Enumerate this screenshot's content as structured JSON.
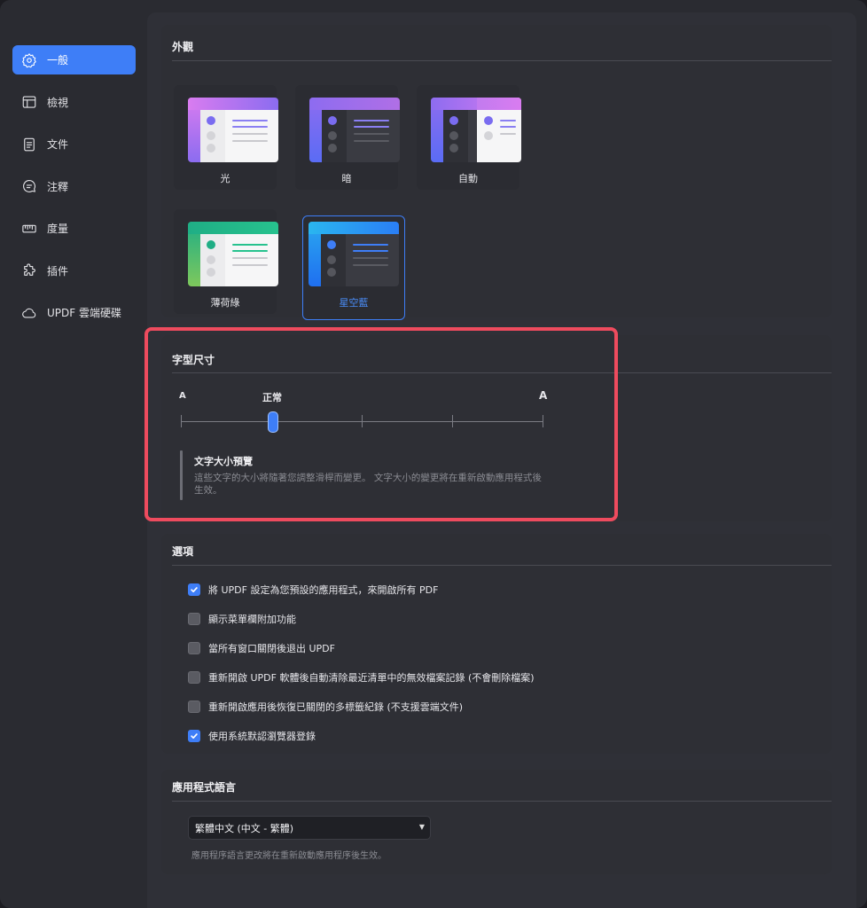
{
  "window": {
    "traffic_lights": {
      "close_color": "#ff5f57",
      "minimize_color": "#febc2e",
      "maximize_color": "#28c840"
    }
  },
  "accent_color": "#3e7ef7",
  "highlight_color": "#ee4b5e",
  "sidebar": {
    "items": [
      {
        "label": "一般",
        "icon": "gear-icon",
        "active": true
      },
      {
        "label": "檢視",
        "icon": "layout-icon",
        "active": false
      },
      {
        "label": "文件",
        "icon": "document-icon",
        "active": false
      },
      {
        "label": "注釋",
        "icon": "comment-icon",
        "active": false
      },
      {
        "label": "度量",
        "icon": "ruler-icon",
        "active": false
      },
      {
        "label": "插件",
        "icon": "puzzle-icon",
        "active": false
      },
      {
        "label": "UPDF 雲端硬碟",
        "icon": "cloud-icon",
        "active": false
      }
    ]
  },
  "appearance": {
    "title": "外觀",
    "themes": [
      {
        "label": "光",
        "selected": false
      },
      {
        "label": "暗",
        "selected": false
      },
      {
        "label": "自動",
        "selected": false
      },
      {
        "label": "薄荷綠",
        "selected": false
      },
      {
        "label": "星空藍",
        "selected": true
      }
    ]
  },
  "font_size": {
    "title": "字型尺寸",
    "min_label": "A",
    "max_label": "A",
    "current_label": "正常",
    "steps": 5,
    "current_step": 2,
    "preview_title": "文字大小預覽",
    "preview_text": "這些文字的大小將隨著您調整滑桿而變更。 文字大小的變更將在重新啟動應用程式後生效。"
  },
  "options": {
    "title": "選項",
    "items": [
      {
        "label": "將 UPDF 設定為您預設的應用程式，來開啟所有 PDF",
        "checked": true
      },
      {
        "label": "顯示菜單欄附加功能",
        "checked": false
      },
      {
        "label": "當所有窗口關閉後退出 UPDF",
        "checked": false
      },
      {
        "label": "重新開啟 UPDF 軟體後自動清除最近清單中的無效檔案記錄 (不會刪除檔案)",
        "checked": false
      },
      {
        "label": "重新開啟應用後恢復已關閉的多標籤紀錄 (不支援雲端文件)",
        "checked": false
      },
      {
        "label": "使用系統默認瀏覽器登錄",
        "checked": true
      }
    ]
  },
  "language": {
    "title": "應用程式語言",
    "selected": "繁體中文 (中文 - 繁體)",
    "hint": "應用程序語言更改將在重新啟動應用程序後生效。"
  }
}
